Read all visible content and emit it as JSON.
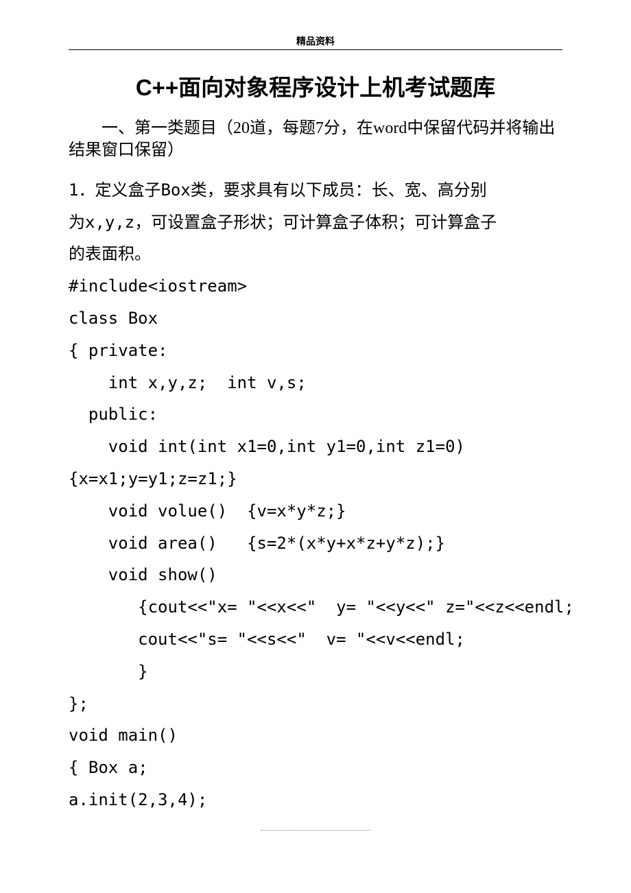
{
  "header": {
    "label": "精品资料"
  },
  "title": "C++面向对象程序设计上机考试题库",
  "section_intro": "一、第一类题目（20道，每题7分，在word中保留代码并将输出结果窗口保留）",
  "lines": [
    "1．定义盒子Box类，要求具有以下成员：长、宽、高分别",
    "为x,y,z，可设置盒子形状；可计算盒子体积；可计算盒子",
    "的表面积。",
    "#include<iostream>",
    "class Box",
    "{ private:",
    "    int x,y,z;  int v,s;",
    "  public:",
    "    void int(int x1=0,int y1=0,int z1=0)",
    "{x=x1;y=y1;z=z1;}",
    "    void volue()  {v=x*y*z;}",
    "    void area()   {s=2*(x*y+x*z+y*z);}",
    "    void show()",
    "       {cout<<\"x= \"<<x<<\"  y= \"<<y<<\" z=\"<<z<<endl;",
    "       cout<<\"s= \"<<s<<\"  v= \"<<v<<endl;",
    "       }",
    "};",
    "void main()",
    "{ Box a;",
    "a.init(2,3,4);"
  ]
}
